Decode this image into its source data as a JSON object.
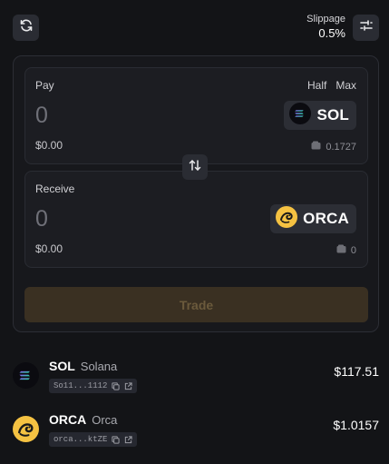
{
  "header": {
    "slippage_label": "Slippage",
    "slippage_value": "0.5%"
  },
  "pay": {
    "label": "Pay",
    "half_label": "Half",
    "max_label": "Max",
    "amount": "0",
    "usd": "$0.00",
    "token_symbol": "SOL",
    "balance": "0.1727"
  },
  "receive": {
    "label": "Receive",
    "amount": "0",
    "usd": "$0.00",
    "token_symbol": "ORCA",
    "balance": "0"
  },
  "trade_button": "Trade",
  "tokens": [
    {
      "symbol": "SOL",
      "name": "Solana",
      "address_short": "So11...1112",
      "price": "$117.51"
    },
    {
      "symbol": "ORCA",
      "name": "Orca",
      "address_short": "orca...ktZE",
      "price": "$1.0157"
    }
  ],
  "colors": {
    "background": "#131417",
    "panel": "#1c1d22",
    "trade_disabled_bg": "#3a3022",
    "orca_yellow": "#f5c242"
  },
  "icons": [
    "refresh-icon",
    "settings-sliders-icon",
    "swap-arrows-icon",
    "wallet-icon",
    "copy-icon",
    "external-link-icon"
  ]
}
